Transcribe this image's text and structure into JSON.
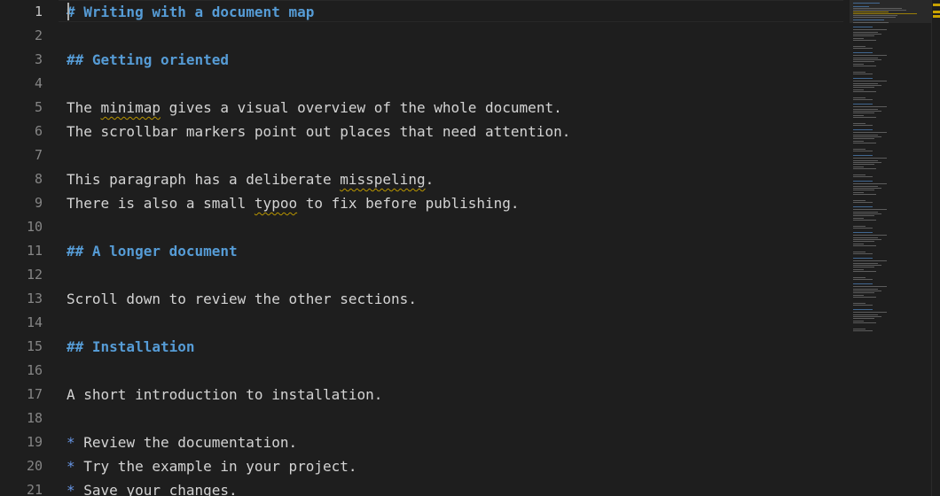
{
  "editor": {
    "lines": [
      {
        "num": "1",
        "text": "# Writing with a document map",
        "kind": "heading"
      },
      {
        "num": "2",
        "text": "",
        "kind": "text"
      },
      {
        "num": "3",
        "text": "## Getting oriented",
        "kind": "heading"
      },
      {
        "num": "4",
        "text": "",
        "kind": "text"
      },
      {
        "num": "5",
        "kind": "text",
        "segments": [
          {
            "t": "The "
          },
          {
            "t": "minimap",
            "err": true
          },
          {
            "t": " gives a visual overview of the whole document."
          }
        ]
      },
      {
        "num": "6",
        "text": "The scrollbar markers point out places that need attention.",
        "kind": "text"
      },
      {
        "num": "7",
        "text": "",
        "kind": "text"
      },
      {
        "num": "8",
        "kind": "text",
        "segments": [
          {
            "t": "This paragraph has a deliberate "
          },
          {
            "t": "misspeling",
            "err": true
          },
          {
            "t": "."
          }
        ]
      },
      {
        "num": "9",
        "kind": "text",
        "segments": [
          {
            "t": "There is also a small "
          },
          {
            "t": "typoo",
            "err": true
          },
          {
            "t": " to fix before publishing."
          }
        ]
      },
      {
        "num": "10",
        "text": "",
        "kind": "text"
      },
      {
        "num": "11",
        "text": "## A longer document",
        "kind": "heading"
      },
      {
        "num": "12",
        "text": "",
        "kind": "text"
      },
      {
        "num": "13",
        "text": "Scroll down to review the other sections.",
        "kind": "text"
      },
      {
        "num": "14",
        "text": "",
        "kind": "text"
      },
      {
        "num": "15",
        "text": "## Installation",
        "kind": "heading"
      },
      {
        "num": "16",
        "text": "",
        "kind": "text"
      },
      {
        "num": "17",
        "text": "A short introduction to installation.",
        "kind": "text"
      },
      {
        "num": "18",
        "text": "",
        "kind": "text"
      },
      {
        "num": "19",
        "kind": "list",
        "bullet": "*",
        "text": " Review the documentation."
      },
      {
        "num": "20",
        "kind": "list",
        "bullet": "*",
        "text": " Try the example in your project."
      },
      {
        "num": "21",
        "kind": "list",
        "bullet": "*",
        "text": " Save your changes."
      }
    ],
    "active_line": "1"
  },
  "colors": {
    "background": "#1e1e1e",
    "heading": "#569cd6",
    "text": "#d4d4d4",
    "line_number": "#858585",
    "spelling_warning": "#b89500"
  }
}
